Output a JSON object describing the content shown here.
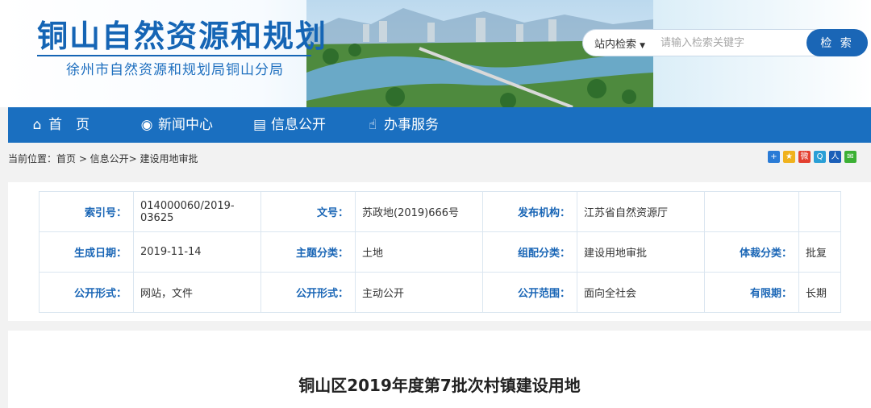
{
  "header": {
    "title": "铜山自然资源和规划",
    "subtitle": "徐州市自然资源和规划局铜山分局"
  },
  "search": {
    "scope_label": "站内检索",
    "placeholder": "请输入检索关键字",
    "button_label": "检 索"
  },
  "nav": {
    "items": [
      {
        "label": "首　页",
        "icon": "home-icon"
      },
      {
        "label": "新闻中心",
        "icon": "globe-icon"
      },
      {
        "label": "信息公开",
        "icon": "document-icon"
      },
      {
        "label": "办事服务",
        "icon": "thumbs-up-icon"
      }
    ]
  },
  "breadcrumb": "当前位置：首页 > 信息公开> 建设用地审批",
  "share": {
    "icons": [
      {
        "name": "add-share-icon",
        "color": "#2a7bd6",
        "glyph": "+"
      },
      {
        "name": "qzone-share-icon",
        "color": "#f0b21d",
        "glyph": "★"
      },
      {
        "name": "weibo-share-icon",
        "color": "#e33f2f",
        "glyph": "微"
      },
      {
        "name": "tencent-share-icon",
        "color": "#2a9fd6",
        "glyph": "Q"
      },
      {
        "name": "renren-share-icon",
        "color": "#1b5fb8",
        "glyph": "人"
      },
      {
        "name": "wechat-share-icon",
        "color": "#3cb034",
        "glyph": "✉"
      }
    ]
  },
  "meta": {
    "rows": [
      [
        {
          "k": "索引号：",
          "v": "014000060/2019-03625"
        },
        {
          "k": "文号：",
          "v": "苏政地(2019)666号"
        },
        {
          "k": "发布机构：",
          "v": "江苏省自然资源厅"
        },
        {
          "k": "",
          "v": ""
        }
      ],
      [
        {
          "k": "生成日期：",
          "v": "2019-11-14"
        },
        {
          "k": "主题分类：",
          "v": "土地"
        },
        {
          "k": "组配分类：",
          "v": "建设用地审批"
        },
        {
          "k": "体裁分类：",
          "v": "批复"
        }
      ],
      [
        {
          "k": "公开形式：",
          "v": "网站，文件"
        },
        {
          "k": "公开形式：",
          "v": "主动公开"
        },
        {
          "k": "公开范围：",
          "v": "面向全社会"
        },
        {
          "k": "有限期：",
          "v": "长期"
        }
      ]
    ]
  },
  "document": {
    "title": "铜山区2019年度第7批次村镇建设用地"
  },
  "colors": {
    "brand": "#1565b5",
    "nav": "#1a6fc0"
  }
}
